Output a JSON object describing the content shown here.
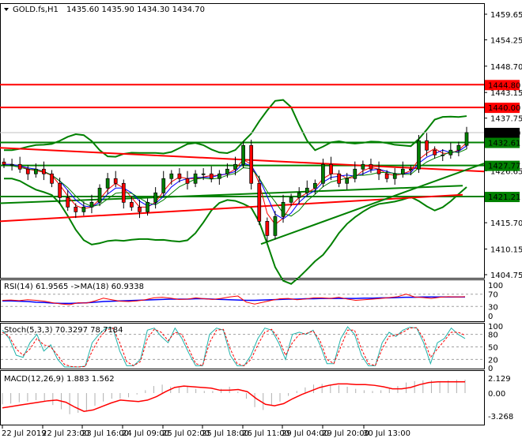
{
  "header": {
    "symbol": "GOLD.fs,H1",
    "ohlc": "1435.60 1435.90 1434.30 1434.70"
  },
  "price_axis": [
    "1459.65",
    "1454.25",
    "1448.70",
    "1443.15",
    "1437.75",
    "1426.65",
    "1415.70",
    "1410.15",
    "1404.75"
  ],
  "price_tags": [
    {
      "label": "1444.80",
      "value": 1444.8,
      "color": "#ff0000"
    },
    {
      "label": "1440.00",
      "value": 1440.0,
      "color": "#ff0000"
    },
    {
      "label": "1434.70",
      "value": 1434.7,
      "color": "#000000"
    },
    {
      "label": "1432.61",
      "value": 1432.61,
      "color": "#008000"
    },
    {
      "label": "1427.77",
      "value": 1427.77,
      "color": "#008000"
    },
    {
      "label": "1421.21",
      "value": 1421.21,
      "color": "#008000"
    }
  ],
  "indicators": {
    "rsi": {
      "label": "RSI(14) 61.9565  ->MA(18) 60.9338",
      "levels": [
        "100",
        "70",
        "30",
        "0"
      ]
    },
    "stoch": {
      "label": "Stoch(5,3,3) 70.3297 78.7184",
      "levels": [
        "100",
        "80",
        "50",
        "20",
        "0"
      ]
    },
    "macd": {
      "label": "MACD(12,26,9) 1.883 1.562",
      "levels": [
        "2.129",
        "0.00",
        "-3.268"
      ]
    }
  },
  "time_axis": [
    "22 Jul 2019",
    "22 Jul 23:00",
    "23 Jul 16:00",
    "24 Jul 09:00",
    "25 Jul 02:00",
    "25 Jul 18:00",
    "26 Jul 11:00",
    "29 Jul 04:00",
    "29 Jul 20:00",
    "30 Jul 13:00"
  ],
  "chart_data": {
    "type": "candlestick",
    "closes": [
      1428,
      1428,
      1427,
      1426,
      1427,
      1426,
      1424,
      1421,
      1419,
      1418,
      1419,
      1420,
      1423,
      1425,
      1424,
      1420,
      1419,
      1418,
      1420,
      1422,
      1425,
      1426,
      1425,
      1424,
      1426,
      1426,
      1425,
      1426,
      1427,
      1428,
      1432,
      1424,
      1416,
      1413,
      1417,
      1420,
      1421,
      1422,
      1423,
      1424,
      1428,
      1426,
      1424,
      1425,
      1427,
      1428,
      1427,
      1426,
      1425,
      1426,
      1427,
      1427,
      1433,
      1431,
      1430,
      1430,
      1431,
      1432,
      1434.7
    ],
    "ylim": [
      1404.75,
      1459.65
    ],
    "horizontal_levels": {
      "red": [
        1444.8,
        1440.0
      ],
      "green": [
        1432.61,
        1427.77,
        1421.21
      ]
    },
    "rsi": [
      50,
      51,
      49,
      52,
      50,
      47,
      42,
      38,
      36,
      42,
      41,
      48,
      57,
      52,
      47,
      46,
      48,
      52,
      58,
      60,
      57,
      53,
      54,
      58,
      55,
      53,
      56,
      61,
      64,
      44,
      38,
      44,
      50,
      55,
      56,
      52,
      54,
      58,
      58,
      56,
      60,
      54,
      50,
      52,
      54,
      56,
      59,
      62,
      70,
      61,
      59,
      56,
      60,
      62,
      61,
      62
    ],
    "rsi_ma": [
      48,
      48,
      47,
      46,
      44,
      43,
      41,
      40,
      40,
      41,
      42,
      44,
      46,
      47,
      48,
      49,
      50,
      51,
      52,
      53,
      54,
      54,
      54,
      55,
      55,
      54,
      53,
      52,
      51,
      50,
      50,
      51,
      52,
      53,
      54,
      54,
      55,
      55,
      56,
      56,
      56,
      56,
      56,
      57,
      57,
      58,
      58,
      59,
      60,
      60,
      61,
      61,
      61,
      61,
      61,
      61
    ],
    "stoch_k": [
      90,
      70,
      30,
      25,
      60,
      80,
      40,
      55,
      20,
      2,
      2,
      2,
      4,
      60,
      80,
      95,
      95,
      40,
      5,
      5,
      20,
      90,
      95,
      75,
      60,
      95,
      70,
      35,
      5,
      5,
      80,
      95,
      90,
      30,
      5,
      5,
      30,
      70,
      95,
      90,
      60,
      20,
      80,
      85,
      80,
      90,
      55,
      10,
      10,
      70,
      98,
      80,
      30,
      5,
      5,
      60,
      85,
      75,
      90,
      97,
      95,
      60,
      10,
      60,
      70,
      95,
      80,
      70
    ],
    "stoch_d": [
      85,
      75,
      45,
      30,
      45,
      70,
      55,
      50,
      30,
      8,
      3,
      2,
      3,
      40,
      70,
      90,
      95,
      60,
      15,
      5,
      15,
      70,
      92,
      85,
      65,
      85,
      80,
      45,
      10,
      5,
      60,
      90,
      92,
      45,
      10,
      5,
      20,
      55,
      85,
      92,
      70,
      30,
      60,
      80,
      82,
      88,
      65,
      20,
      10,
      50,
      90,
      90,
      45,
      10,
      5,
      45,
      75,
      78,
      85,
      95,
      96,
      70,
      25,
      45,
      65,
      85,
      85,
      78
    ],
    "macd_hist": [
      -1.6,
      -1.5,
      -1.3,
      -1.2,
      -1.0,
      -1.1,
      -1.7,
      -2.3,
      -3.0,
      -2.8,
      -2.5,
      -1.8,
      -1.2,
      -0.8,
      -0.8,
      -0.6,
      -0.2,
      0.4,
      1.0,
      1.2,
      0.9,
      0.8,
      0.9,
      0.6,
      0.3,
      0.3,
      0.6,
      0.9,
      0.2,
      -0.8,
      -2.0,
      -2.4,
      -1.8,
      -1.2,
      -0.4,
      0.3,
      0.8,
      1.2,
      1.3,
      1.2,
      1.1,
      0.9,
      0.6,
      0.4,
      0.3,
      0.4,
      0.6,
      1.0,
      1.5,
      1.7,
      1.8,
      1.8,
      1.7,
      1.8,
      1.9,
      1.9
    ],
    "macd_signal": [
      -2.1,
      -1.9,
      -1.7,
      -1.5,
      -1.3,
      -1.1,
      -1.0,
      -1.3,
      -2.0,
      -2.6,
      -2.4,
      -1.9,
      -1.4,
      -1.0,
      -1.1,
      -1.2,
      -1.0,
      -0.5,
      0.2,
      0.8,
      1.0,
      0.9,
      0.8,
      0.7,
      0.4,
      0.4,
      0.5,
      0.2,
      -0.8,
      -1.6,
      -1.8,
      -1.5,
      -0.8,
      -0.2,
      0.3,
      0.8,
      1.1,
      1.3,
      1.3,
      1.2,
      1.2,
      1.1,
      0.9,
      0.6,
      0.6,
      0.8,
      1.2,
      1.5,
      1.6,
      1.6,
      1.6,
      1.6
    ]
  }
}
